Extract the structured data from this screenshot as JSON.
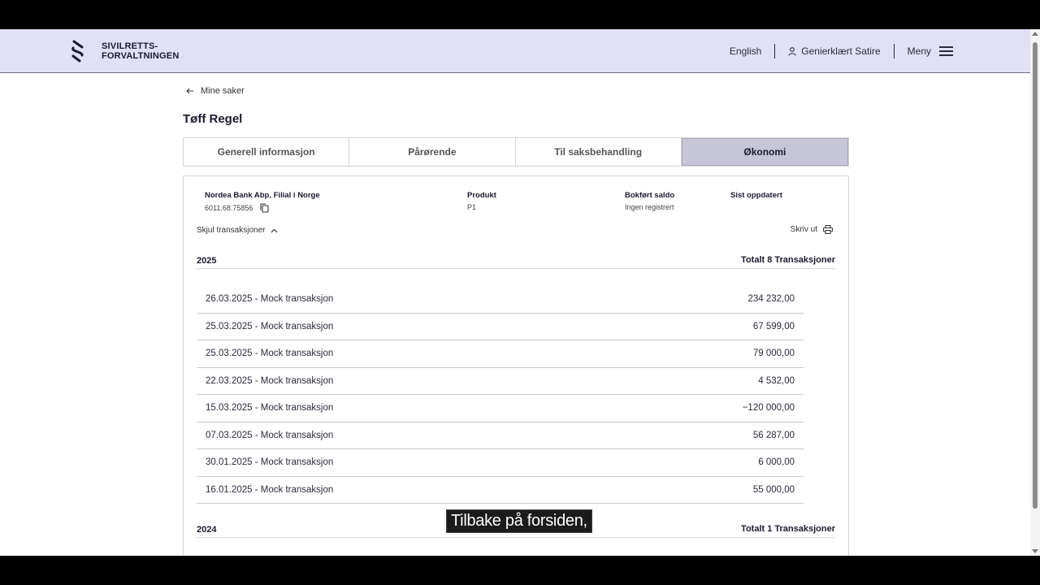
{
  "header": {
    "logo_line1": "SIVILRETTS-",
    "logo_line2": "FORVALTNINGEN",
    "language": "English",
    "user_name": "Genierklært Satire",
    "menu_label": "Meny"
  },
  "back_link": "Mine saker",
  "page_title": "Tøff Regel",
  "tabs": [
    {
      "label": "Generell informasjon",
      "active": false
    },
    {
      "label": "Pårørende",
      "active": false
    },
    {
      "label": "Til saksbehandling",
      "active": false
    },
    {
      "label": "Økonomi",
      "active": true
    }
  ],
  "account": {
    "bank_name": "Nordea Bank Abp, Filial i Norge",
    "account_number": "6011.68.75856",
    "product_label": "Produkt",
    "product_value": "P1",
    "balance_label": "Bokført saldo",
    "balance_value": "Ingen registrert",
    "updated_label": "Sist oppdatert",
    "updated_value": ""
  },
  "toggle_transactions": "Skjul transaksjoner",
  "print_label": "Skriv ut",
  "years": [
    {
      "year": "2025",
      "total": "Totalt 8 Transaksjoner",
      "transactions": [
        {
          "desc": "26.03.2025 - Mock transaksjon",
          "amount": "234 232,00"
        },
        {
          "desc": "25.03.2025 - Mock transaksjon",
          "amount": "67 599,00"
        },
        {
          "desc": "25.03.2025 - Mock transaksjon",
          "amount": "79 000,00"
        },
        {
          "desc": "22.03.2025 - Mock transaksjon",
          "amount": "4 532,00"
        },
        {
          "desc": "15.03.2025 - Mock transaksjon",
          "amount": "−120 000,00"
        },
        {
          "desc": "07.03.2025 - Mock transaksjon",
          "amount": "56 287,00"
        },
        {
          "desc": "30.01.2025 - Mock transaksjon",
          "amount": "6 000,00"
        },
        {
          "desc": "16.01.2025 - Mock transaksjon",
          "amount": "55 000,00"
        }
      ]
    },
    {
      "year": "2024",
      "total": "Totalt 1 Transaksjoner",
      "transactions": []
    }
  ],
  "caption": "Tilbake på forsiden,"
}
